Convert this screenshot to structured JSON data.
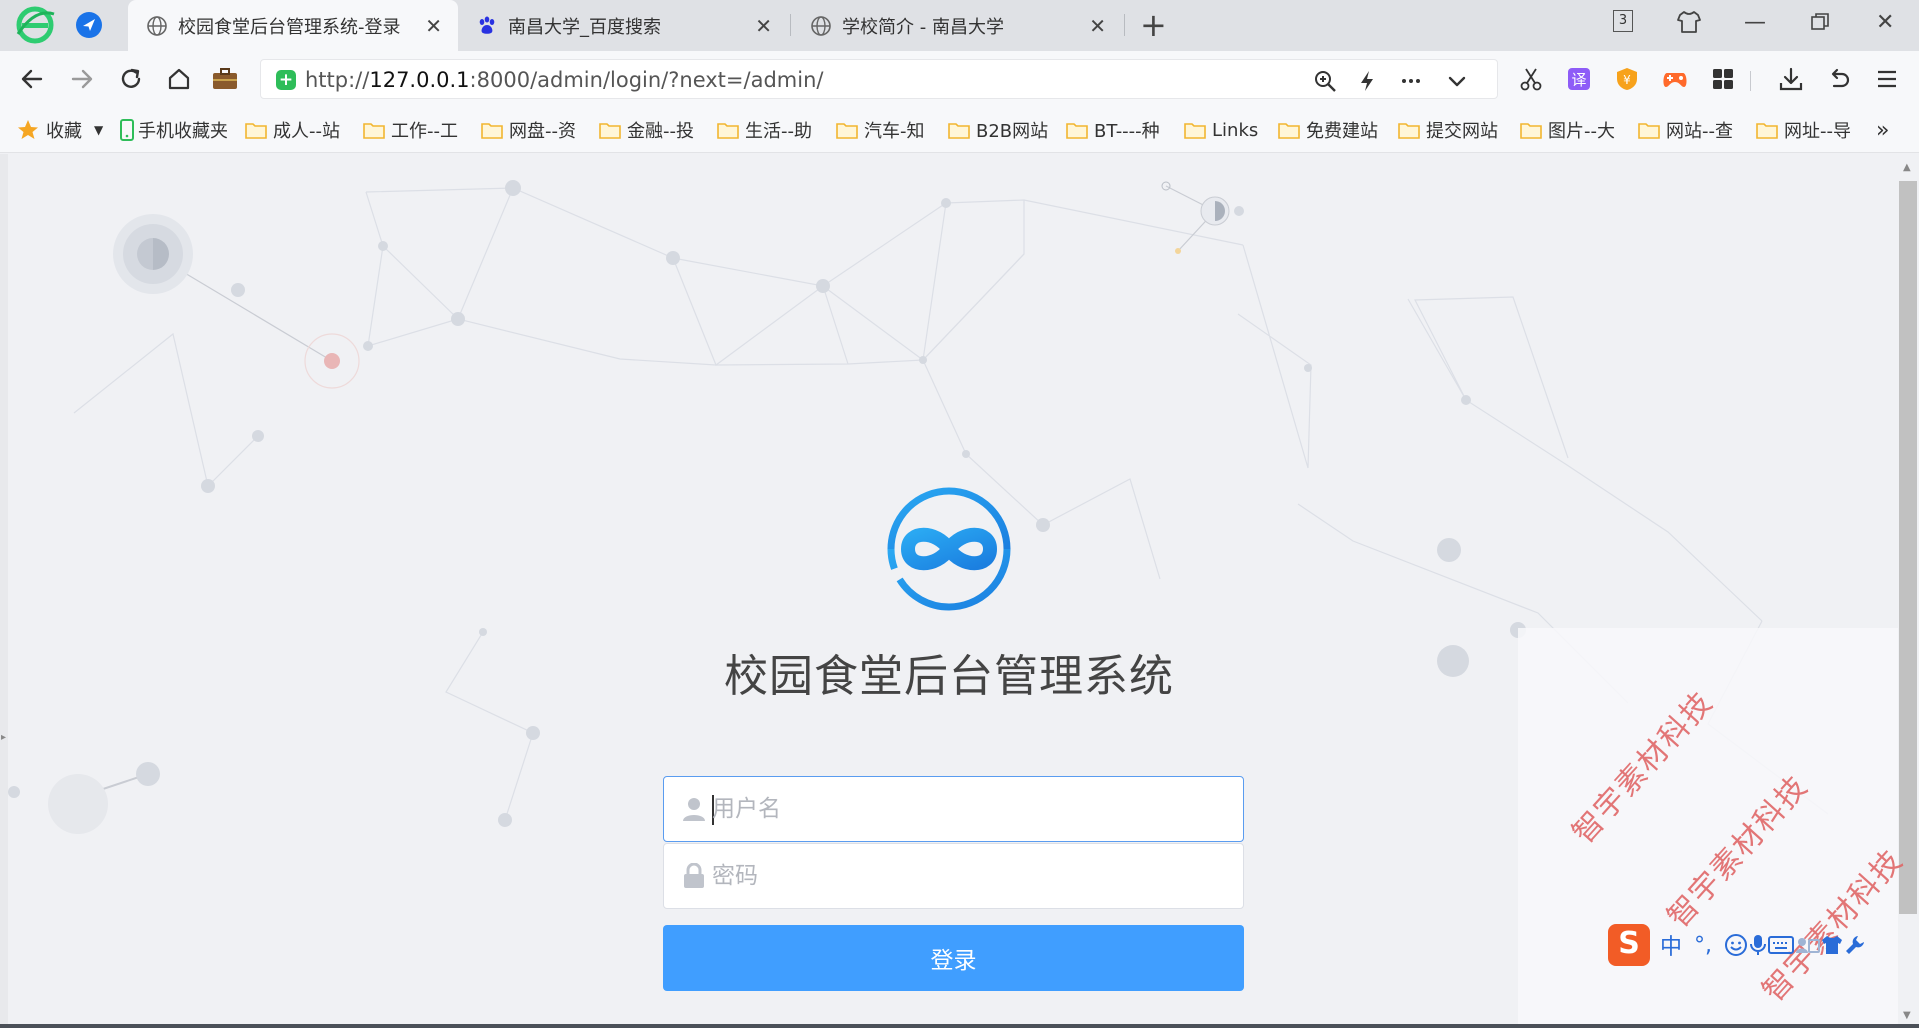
{
  "browser": {
    "tabs": [
      {
        "title": "校园食堂后台管理系统-登录",
        "active": true,
        "favicon": "globe-icon"
      },
      {
        "title": "南昌大学_百度搜索",
        "active": false,
        "favicon": "baidu-paw-icon"
      },
      {
        "title": "学校简介 - 南昌大学",
        "active": false,
        "favicon": "globe-icon"
      }
    ],
    "tab_count": "3",
    "address": {
      "scheme": "http://",
      "host": "127.0.0.1",
      "rest": ":8000/admin/login/?next=/admin/"
    },
    "bookmarks": [
      {
        "label": "收藏",
        "icon": "star-icon"
      },
      {
        "label": "手机收藏夹",
        "icon": "phone-icon"
      },
      {
        "label": "成人--站",
        "icon": "folder-icon"
      },
      {
        "label": "工作--工",
        "icon": "folder-icon"
      },
      {
        "label": "网盘--资",
        "icon": "folder-icon"
      },
      {
        "label": "金融--投",
        "icon": "folder-icon"
      },
      {
        "label": "生活--助",
        "icon": "folder-icon"
      },
      {
        "label": "汽车-知",
        "icon": "folder-icon"
      },
      {
        "label": "B2B网站",
        "icon": "folder-icon"
      },
      {
        "label": "BT----种",
        "icon": "folder-icon"
      },
      {
        "label": "Links",
        "icon": "folder-icon"
      },
      {
        "label": "免费建站",
        "icon": "folder-icon"
      },
      {
        "label": "提交网站",
        "icon": "folder-icon"
      },
      {
        "label": "图片--大",
        "icon": "folder-icon"
      },
      {
        "label": "网站--查",
        "icon": "folder-icon"
      },
      {
        "label": "网址--导",
        "icon": "folder-icon"
      }
    ],
    "bookmarks_more": "»",
    "colors": {
      "accent": "#409eff",
      "secure": "#2ebd59",
      "folder": "#f2b630"
    }
  },
  "login": {
    "title": "校园食堂后台管理系统",
    "username_placeholder": "用户名",
    "password_placeholder": "密码",
    "submit_label": "登录"
  },
  "watermark": [
    "智宇素材科技",
    "智宇素材科技",
    "智宇素材科技"
  ],
  "ime": {
    "mode": "中",
    "punct": "°,"
  }
}
